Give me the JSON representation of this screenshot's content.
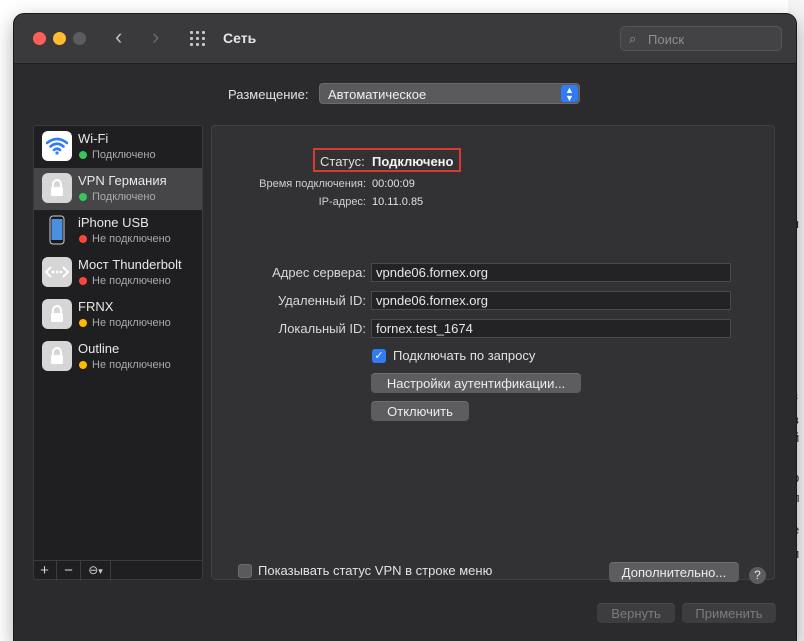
{
  "window": {
    "title": "Сеть",
    "search_placeholder": "Поиск"
  },
  "location": {
    "label": "Размещение:",
    "value": "Автоматическое"
  },
  "services": [
    {
      "name": "Wi-Fi",
      "status": "Подключено",
      "status_color": "#34c759",
      "icon": "wifi-icon"
    },
    {
      "name": "VPN Германия",
      "status": "Подключено",
      "status_color": "#34c759",
      "icon": "lock-icon"
    },
    {
      "name": "iPhone USB",
      "status": "Не подключено",
      "status_color": "#ff453a",
      "icon": "iphone-icon"
    },
    {
      "name": "Мост Thunderbolt",
      "status": "Не подключено",
      "status_color": "#ff453a",
      "icon": "thunderbolt-bridge-icon"
    },
    {
      "name": "FRNX",
      "status": "Не подключено",
      "status_color": "#ffb800",
      "icon": "lock-icon"
    },
    {
      "name": "Outline",
      "status": "Не подключено",
      "status_color": "#ffb800",
      "icon": "lock-icon"
    }
  ],
  "sidebar_footer": {
    "add": "+",
    "remove": "−",
    "action": "⊖"
  },
  "detail": {
    "status_label": "Статус:",
    "status_value": "Подключено",
    "connect_time_label": "Время подключения:",
    "connect_time_value": "00:00:09",
    "ip_label": "IP-адрес:",
    "ip_value": "10.11.0.85",
    "server_label": "Адрес сервера:",
    "server_value": "vpnde06.fornex.org",
    "remote_id_label": "Удаленный ID:",
    "remote_id_value": "vpnde06.fornex.org",
    "local_id_label": "Локальный ID:",
    "local_id_value": "fornex.test_1674",
    "on_demand_label": "Подключать по запросу",
    "on_demand_checked": true,
    "auth_button": "Настройки аутентификации...",
    "disconnect_button": "Отключить",
    "show_status_label": "Показывать статус VPN в строке меню",
    "show_status_checked": false,
    "advanced_button": "Дополнительно...",
    "help_button": "?"
  },
  "footer": {
    "revert_button": "Вернуть",
    "apply_button": "Применить"
  },
  "accent_color": "#2f7cf6"
}
